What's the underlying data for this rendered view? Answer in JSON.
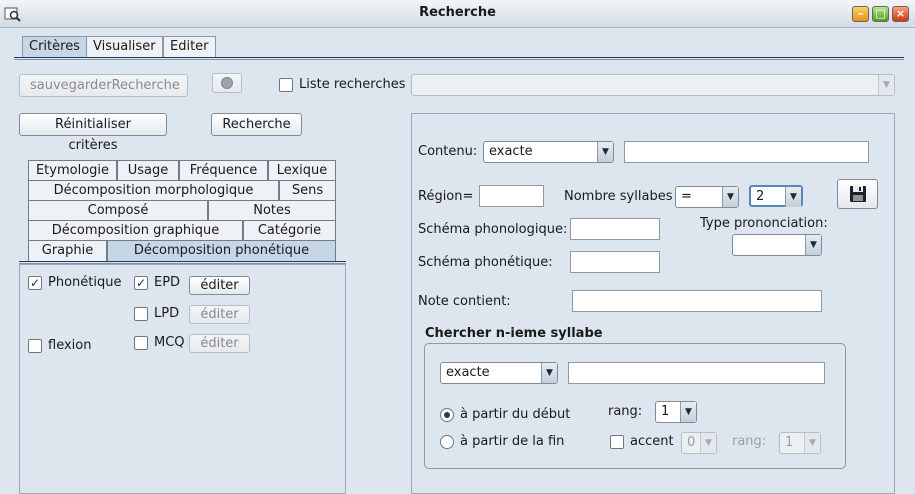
{
  "window": {
    "title": "Recherche"
  },
  "top_tabs": [
    "Critères",
    "Visualiser",
    "Editer"
  ],
  "toolbar": {
    "save_label": "sauvegarderRecherche",
    "list_label": "Liste recherches",
    "reset_label": "Réinitialiser critères",
    "search_label": "Recherche"
  },
  "subtabs": {
    "row1": [
      "Etymologie",
      "Usage",
      "Fréquence",
      "Lexique"
    ],
    "row2": [
      "Décomposition morphologique",
      "Sens"
    ],
    "row3": [
      "Composé",
      "Notes"
    ],
    "row4": [
      "Décomposition graphique",
      "Catégorie"
    ],
    "row5": [
      "Graphie",
      "Décomposition phonétique"
    ]
  },
  "left_panel": {
    "phonetique": "Phonétique",
    "epd": "EPD",
    "lpd": "LPD",
    "mcq": "MCQ",
    "flexion": "flexion",
    "edit": "éditer"
  },
  "right": {
    "contenu_label": "Contenu:",
    "contenu_mode": "exacte",
    "region_label": "Région=",
    "syllables_label": "Nombre syllabes",
    "syllables_op": "=",
    "syllables_value": "2",
    "schema_phonologique_label": "Schéma phonologique:",
    "schema_phonetique_label": "Schéma phonétique:",
    "type_prononciation_label": "Type prononciation:",
    "note_label": "Note contient:",
    "nieme_title": "Chercher n-ieme syllabe",
    "nieme_mode": "exacte",
    "from_start": "à partir du début",
    "from_end": "à partir de la fin",
    "rang_label": "rang:",
    "rang_value": "1",
    "accent_label": "accent",
    "accent_value": "0",
    "rang2_value": "1"
  },
  "icons": [
    "search-window-icon",
    "minimize-icon",
    "maximize-icon",
    "close-icon",
    "save-disk-icon",
    "record-icon",
    "combo-arrow-icon"
  ]
}
